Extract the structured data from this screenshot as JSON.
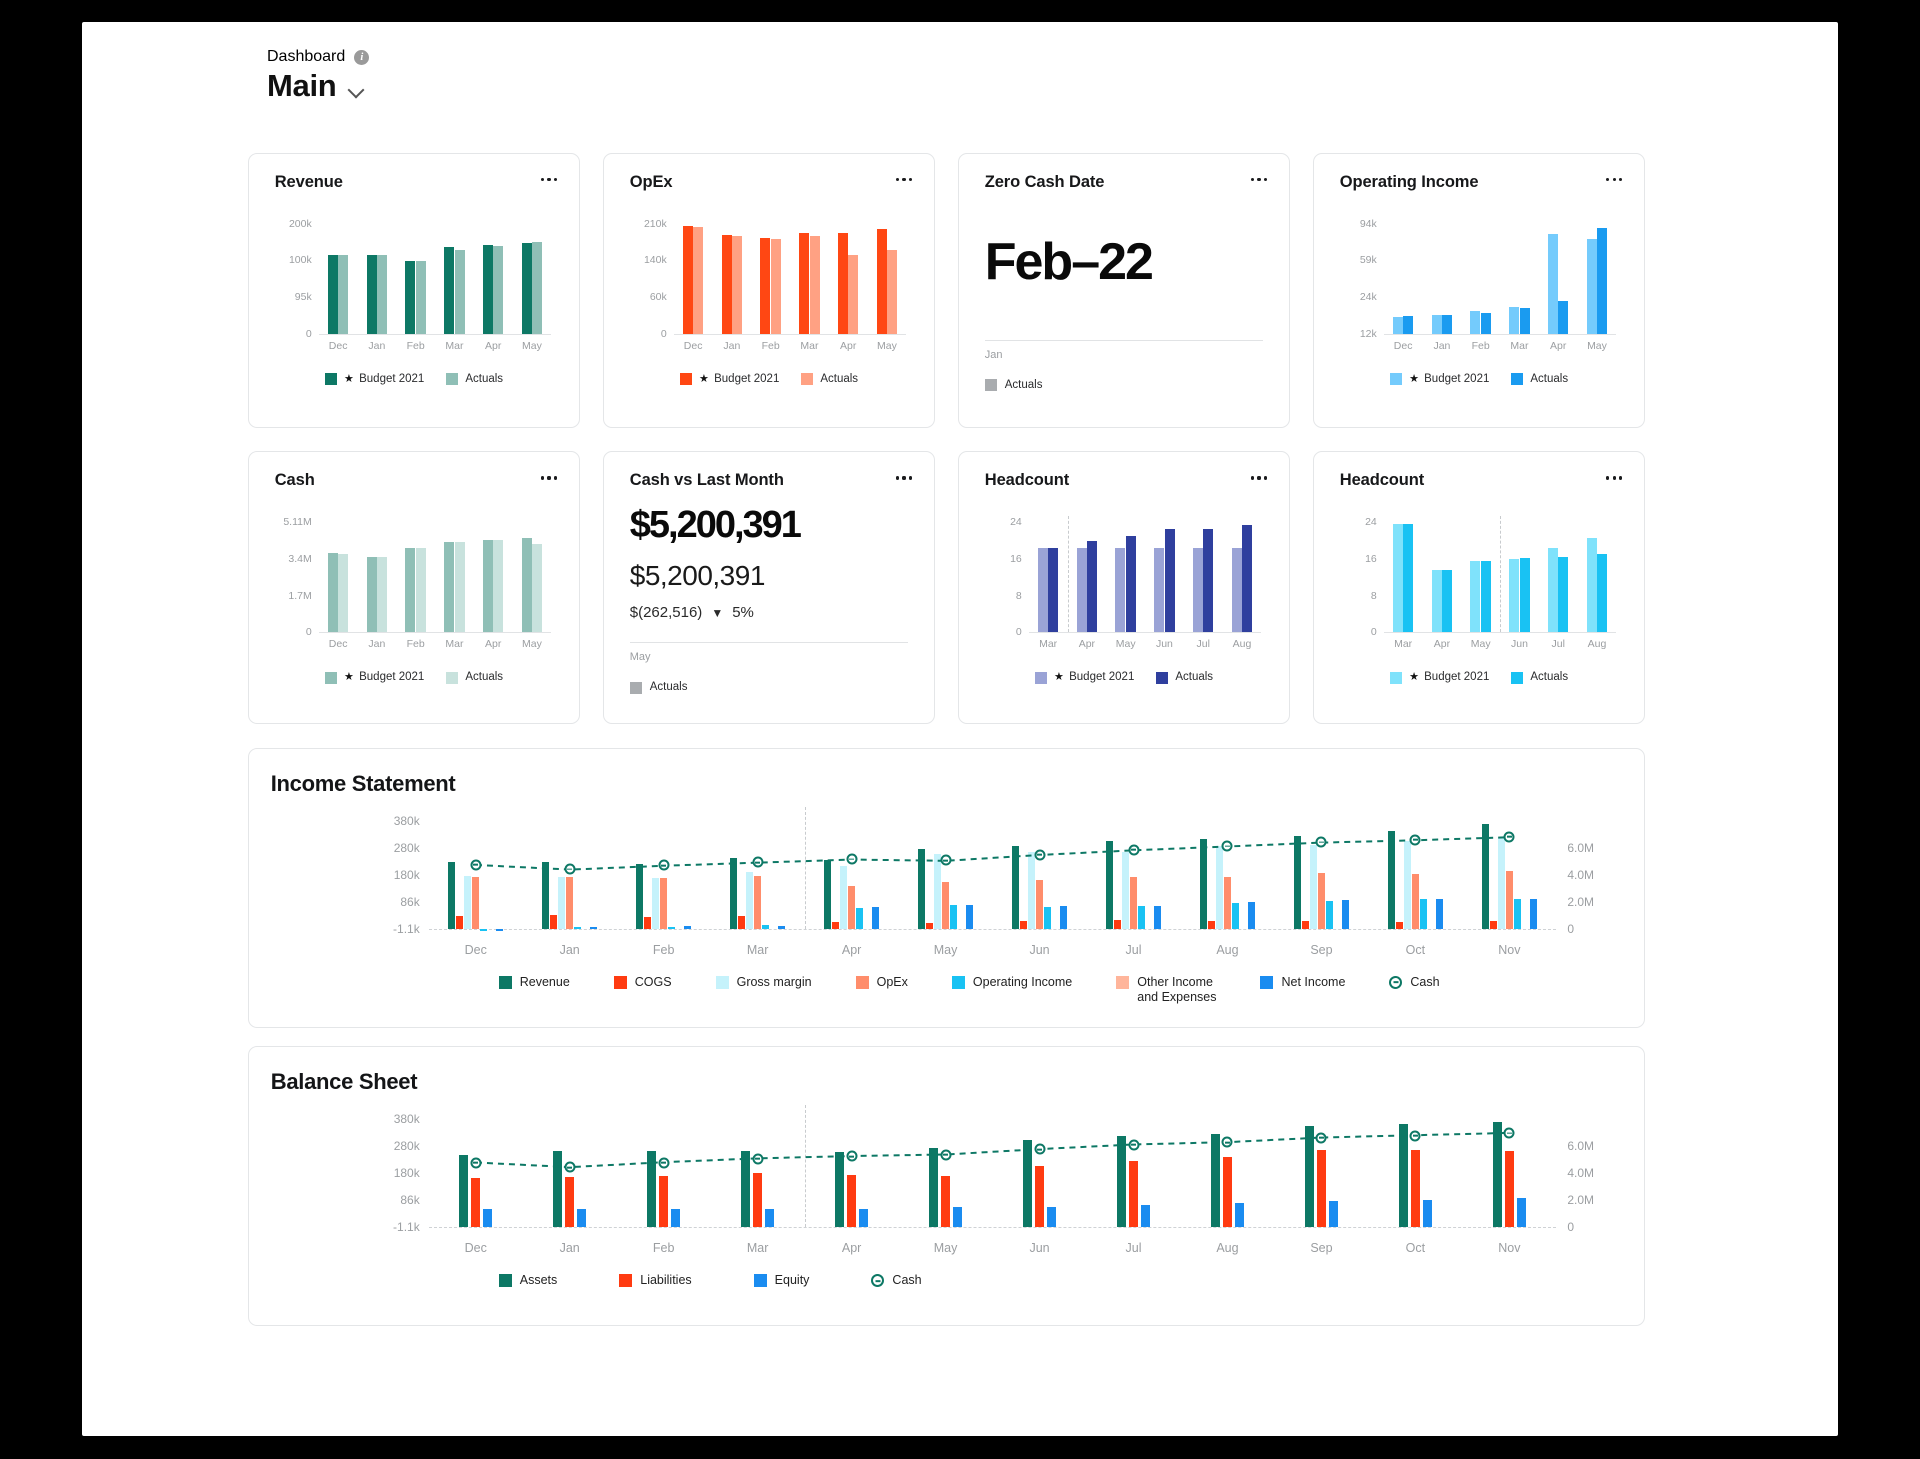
{
  "header": {
    "breadcrumb": "Dashboard",
    "info_icon": "info-icon",
    "title": "Main",
    "chevron": "chevron-down-icon"
  },
  "colors": {
    "teal_dark": "#0d7865",
    "teal_light": "#8fbfb6",
    "teal_pale": "#c8e2dd",
    "orange": "#ff4713",
    "orange_light": "#ffa183",
    "blue": "#1a9bf0",
    "blue_light": "#74cbfc",
    "cyan": "#19c2f3",
    "cyan_light": "#7fe2fb",
    "indigo": "#2f3f9e",
    "indigo_light": "#9aa3d6",
    "gray": "#a9acaf",
    "axis": "#9b9ea1"
  },
  "legend_labels": {
    "budget": "Budget 2021",
    "actuals": "Actuals",
    "star": "★"
  },
  "cards": [
    {
      "name": "revenue",
      "title": "Revenue",
      "menu": "kebab-menu-icon",
      "chart_data": {
        "type": "bar",
        "title": "Revenue",
        "categories": [
          "Dec",
          "Jan",
          "Feb",
          "Mar",
          "Apr",
          "May"
        ],
        "ytick_labels": [
          "200k",
          "100k",
          "95k",
          "0"
        ],
        "ylim": [
          0,
          200000
        ],
        "series": [
          {
            "name": "Budget 2021",
            "color": "#0d7865",
            "values": [
              143000,
              143000,
              133000,
              157000,
              162000,
              165000
            ]
          },
          {
            "name": "Actuals",
            "color": "#8fbfb6",
            "values": [
              143000,
              143000,
              133000,
              153000,
              160000,
              166000
            ]
          }
        ]
      }
    },
    {
      "name": "opex",
      "title": "OpEx",
      "menu": "kebab-menu-icon",
      "chart_data": {
        "type": "bar",
        "title": "OpEx",
        "categories": [
          "Dec",
          "Jan",
          "Feb",
          "Mar",
          "Apr",
          "May"
        ],
        "ytick_labels": [
          "210k",
          "140k",
          "60k",
          "0"
        ],
        "ylim": [
          0,
          210000
        ],
        "series": [
          {
            "name": "Budget 2021",
            "color": "#ff4713",
            "values": [
              205000,
              188000,
              182000,
              192000,
              193000,
              200000
            ]
          },
          {
            "name": "Actuals",
            "color": "#ffa183",
            "values": [
              203000,
              187000,
              181000,
              186000,
              151000,
              159000
            ]
          }
        ]
      }
    },
    {
      "name": "zero-cash-date",
      "title": "Zero Cash Date",
      "menu": "kebab-menu-icon",
      "value": "Feb–22",
      "footer_label": "Jan",
      "legend": "Actuals"
    },
    {
      "name": "operating-income",
      "title": "Operating Income",
      "menu": "kebab-menu-icon",
      "chart_data": {
        "type": "bar",
        "title": "Operating Income",
        "categories": [
          "Dec",
          "Jan",
          "Feb",
          "Mar",
          "Apr",
          "May"
        ],
        "ytick_labels": [
          "94k",
          "59k",
          "24k",
          "12k"
        ],
        "ylim": [
          0,
          94000
        ],
        "series": [
          {
            "name": "Budget 2021",
            "color": "#74cbfc",
            "values": [
              14000,
              16000,
              19000,
              23000,
              85000,
              81000
            ]
          },
          {
            "name": "Actuals",
            "color": "#1a9bf0",
            "values": [
              15000,
              16000,
              18000,
              22000,
              28000,
              90000
            ]
          }
        ]
      }
    },
    {
      "name": "cash",
      "title": "Cash",
      "menu": "kebab-menu-icon",
      "chart_data": {
        "type": "bar",
        "title": "Cash",
        "categories": [
          "Dec",
          "Jan",
          "Feb",
          "Mar",
          "Apr",
          "May"
        ],
        "ytick_labels": [
          "5.11M",
          "3.4M",
          "1.7M",
          "0"
        ],
        "ylim": [
          0,
          5110000
        ],
        "series": [
          {
            "name": "Budget 2021",
            "color": "#8fbfb6",
            "values": [
              3700000,
              3500000,
              3900000,
              4200000,
              4300000,
              4400000
            ]
          },
          {
            "name": "Actuals",
            "color": "#c8e2dd",
            "values": [
              3650000,
              3520000,
              3900000,
              4200000,
              4300000,
              4100000
            ]
          }
        ]
      }
    },
    {
      "name": "cash-vs-last-month",
      "title": "Cash vs Last Month",
      "menu": "kebab-menu-icon",
      "value": "$5,200,391",
      "subvalue": "$5,200,391",
      "delta_amount": "$(262,516)",
      "delta_arrow": "▼",
      "delta_pct": "5%",
      "footer_label": "May",
      "legend": "Actuals"
    },
    {
      "name": "headcount-indigo",
      "title": "Headcount",
      "menu": "kebab-menu-icon",
      "chart_data": {
        "type": "bar",
        "title": "Headcount",
        "categories": [
          "Mar",
          "Apr",
          "May",
          "Jun",
          "Jul",
          "Aug"
        ],
        "ytick_labels": [
          "24",
          "16",
          "8",
          "0"
        ],
        "ylim": [
          0,
          24
        ],
        "forecast_divider_after": "Mar",
        "series": [
          {
            "name": "Budget 2021",
            "color": "#9aa3d6",
            "values": [
              18.5,
              18.5,
              18.5,
              18.5,
              18.5,
              18.5
            ]
          },
          {
            "name": "Actuals",
            "color": "#2f3f9e",
            "values": [
              18.5,
              20,
              21,
              22.5,
              22.5,
              23.5
            ]
          }
        ]
      }
    },
    {
      "name": "headcount-cyan",
      "title": "Headcount",
      "menu": "kebab-menu-icon",
      "chart_data": {
        "type": "bar",
        "title": "Headcount",
        "categories": [
          "Mar",
          "Apr",
          "May",
          "Jun",
          "Jul",
          "Aug"
        ],
        "ytick_labels": [
          "24",
          "16",
          "8",
          "0"
        ],
        "ylim": [
          0,
          24
        ],
        "forecast_divider_after": "May",
        "series": [
          {
            "name": "Budget 2021",
            "color": "#7fe2fb",
            "values": [
              23.7,
              13.5,
              15.6,
              16.1,
              18.5,
              20.5
            ]
          },
          {
            "name": "Actuals",
            "color": "#19c2f3",
            "values": [
              23.7,
              13.5,
              15.6,
              16.2,
              16.5,
              17.2
            ]
          }
        ]
      }
    }
  ],
  "panels": [
    {
      "name": "income-statement",
      "title": "Income Statement",
      "chart_data": {
        "type": "bar",
        "title": "Income Statement",
        "categories": [
          "Dec",
          "Jan",
          "Feb",
          "Mar",
          "Apr",
          "May",
          "Jun",
          "Jul",
          "Aug",
          "Sep",
          "Oct",
          "Nov"
        ],
        "ytick_labels": [
          "380k",
          "280k",
          "180k",
          "86k",
          "-1.1k"
        ],
        "ylim": [
          -1100,
          380000
        ],
        "y2tick_labels": [
          "6.0M",
          "4.0M",
          "2.0M",
          "0"
        ],
        "y2lim": [
          0,
          7000000
        ],
        "forecast_divider_after": "Mar",
        "series": [
          {
            "name": "Revenue",
            "color": "#0d7865",
            "values": [
              236000,
              236000,
              229000,
              247000,
              243000,
              279000,
              291000,
              307000,
              317000,
              325000,
              344000,
              368000
            ]
          },
          {
            "name": "COGS",
            "color": "#ff3b11",
            "values": [
              46000,
              47000,
              42000,
              46000,
              22000,
              21000,
              26000,
              30000,
              26000,
              27000,
              24000,
              27000
            ]
          },
          {
            "name": "Gross margin",
            "color": "#c5f2fb",
            "values": [
              184000,
              183000,
              179000,
              199000,
              222000,
              263000,
              270000,
              271000,
              290000,
              295000,
              310000,
              318000
            ]
          },
          {
            "name": "OpEx",
            "color": "#ff8d6b",
            "values": [
              183000,
              181000,
              179000,
              186000,
              150000,
              163000,
              170000,
              182000,
              181000,
              196000,
              192000,
              203000
            ]
          },
          {
            "name": "Operating Income",
            "color": "#19c2f3",
            "values": [
              -6000,
              4000,
              4000,
              12000,
              74000,
              82000,
              76000,
              80000,
              90000,
              96000,
              104000,
              103000
            ]
          },
          {
            "name": "Other Income and Expenses",
            "color": "#ffb59b",
            "values": [
              0,
              0,
              0,
              0,
              0,
              0,
              0,
              0,
              0,
              0,
              0,
              0
            ]
          },
          {
            "name": "Net Income",
            "color": "#1a8cf0",
            "values": [
              -7000,
              7000,
              9000,
              8000,
              76000,
              84000,
              80000,
              80000,
              93000,
              100000,
              106000,
              104000
            ]
          }
        ],
        "line_series": {
          "name": "Cash",
          "color": "#0d7865",
          "style": "dashed",
          "axis": "y2",
          "values": [
            4150000,
            3850000,
            4100000,
            4300000,
            4500000,
            4420000,
            4800000,
            5100000,
            5350000,
            5600000,
            5750000,
            5950000
          ]
        }
      },
      "legend": [
        {
          "label": "Revenue",
          "color": "#0d7865",
          "shape": "square"
        },
        {
          "label": "COGS",
          "color": "#ff3b11",
          "shape": "square"
        },
        {
          "label": "Gross margin",
          "color": "#c5f2fb",
          "shape": "square"
        },
        {
          "label": "OpEx",
          "color": "#ff8d6b",
          "shape": "square"
        },
        {
          "label": "Operating Income",
          "color": "#19c2f3",
          "shape": "square"
        },
        {
          "label": "Other Income\nand Expenses",
          "color": "#ffb59b",
          "shape": "square"
        },
        {
          "label": "Net Income",
          "color": "#1a8cf0",
          "shape": "square"
        },
        {
          "label": "Cash",
          "color": "#0d7865",
          "shape": "ring"
        }
      ]
    },
    {
      "name": "balance-sheet",
      "title": "Balance Sheet",
      "chart_data": {
        "type": "bar",
        "title": "Balance Sheet",
        "categories": [
          "Dec",
          "Jan",
          "Feb",
          "Mar",
          "Apr",
          "May",
          "Jun",
          "Jul",
          "Aug",
          "Sep",
          "Oct",
          "Nov"
        ],
        "ytick_labels": [
          "380k",
          "280k",
          "180k",
          "86k",
          "-1.1k"
        ],
        "ylim": [
          -1100,
          380000
        ],
        "y2tick_labels": [
          "6.0M",
          "4.0M",
          "2.0M",
          "0"
        ],
        "y2lim": [
          0,
          7000000
        ],
        "forecast_divider_after": "Mar",
        "series": [
          {
            "name": "Assets",
            "color": "#0d7865",
            "values": [
              256000,
              268000,
              268000,
              268000,
              266000,
              278000,
              307000,
              321000,
              330000,
              355000,
              362000,
              370000
            ]
          },
          {
            "name": "Liabilities",
            "color": "#ff3b11",
            "values": [
              175000,
              178000,
              181000,
              190000,
              183000,
              182000,
              215000,
              233000,
              246000,
              272000,
              271000,
              270000
            ]
          },
          {
            "name": "Equity",
            "color": "#1a8cf0",
            "values": [
              63000,
              63000,
              63000,
              64000,
              63000,
              71000,
              70000,
              78000,
              85000,
              92000,
              95000,
              105000
            ]
          }
        ],
        "line_series": {
          "name": "Cash",
          "color": "#0d7865",
          "style": "dashed",
          "axis": "y2",
          "values": [
            4180000,
            3880000,
            4200000,
            4450000,
            4600000,
            4700000,
            5050000,
            5350000,
            5500000,
            5800000,
            5950000,
            6100000
          ]
        }
      },
      "legend": [
        {
          "label": "Assets",
          "color": "#0d7865",
          "shape": "square"
        },
        {
          "label": "Liabilities",
          "color": "#ff3b11",
          "shape": "square"
        },
        {
          "label": "Equity",
          "color": "#1a8cf0",
          "shape": "square"
        },
        {
          "label": "Cash",
          "color": "#0d7865",
          "shape": "ring"
        }
      ]
    }
  ]
}
